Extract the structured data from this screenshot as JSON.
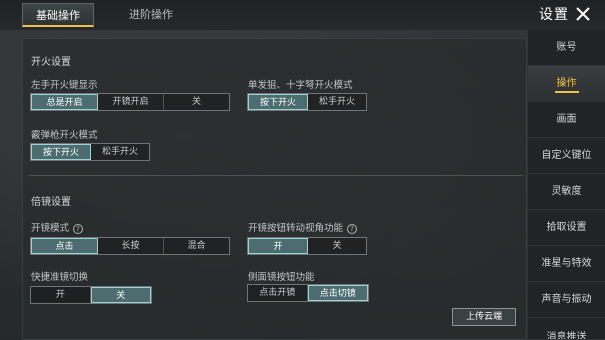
{
  "tabs": [
    {
      "label": "基础操作",
      "active": true
    },
    {
      "label": "进阶操作",
      "active": false
    }
  ],
  "header": {
    "title": "设置",
    "close_icon": "close-icon"
  },
  "fire_section": {
    "title": "开火设置",
    "left_fire_button": {
      "label": "左手开火键显示",
      "options": [
        "总是开启",
        "开镜开启",
        "关"
      ],
      "selected": 0
    },
    "single_shot_mode": {
      "label": "单发狙、十字弩开火模式",
      "options": [
        "按下开火",
        "松手开火"
      ],
      "selected": 0
    },
    "shotgun_mode": {
      "label": "霰弹枪开火模式",
      "options": [
        "按下开火",
        "松手开火"
      ],
      "selected": 0
    }
  },
  "scope_section": {
    "title": "倍镜设置",
    "scope_mode": {
      "label": "开镜模式",
      "help_icon": "help-icon",
      "options": [
        "点击",
        "长按",
        "混合"
      ],
      "selected": 0
    },
    "scope_rotate": {
      "label": "开镜按钮转动视角功能",
      "help_icon": "help-icon",
      "options": [
        "开",
        "关"
      ],
      "selected": 0
    },
    "quick_scope_switch": {
      "label": "快捷准镜切换",
      "options": [
        "开",
        "关"
      ],
      "selected": 1
    },
    "side_scope_button": {
      "label": "侧面镜按钮功能",
      "options": [
        "点击开镜",
        "点击切镜"
      ],
      "selected": 1
    }
  },
  "sidebar": {
    "items": [
      {
        "label": "账号",
        "active": false
      },
      {
        "label": "操作",
        "active": true
      },
      {
        "label": "画面",
        "active": false
      },
      {
        "label": "自定义键位",
        "active": false
      },
      {
        "label": "灵敏度",
        "active": false
      },
      {
        "label": "拾取设置",
        "active": false
      },
      {
        "label": "准星与特效",
        "active": false
      },
      {
        "label": "声音与振动",
        "active": false
      },
      {
        "label": "消息推送",
        "active": false
      }
    ]
  },
  "upload_button": {
    "label": "上传云端"
  },
  "colors": {
    "accent": "#f0c24a",
    "selected_bg": "#4c6c70",
    "selected_border": "#9fd2d4"
  }
}
